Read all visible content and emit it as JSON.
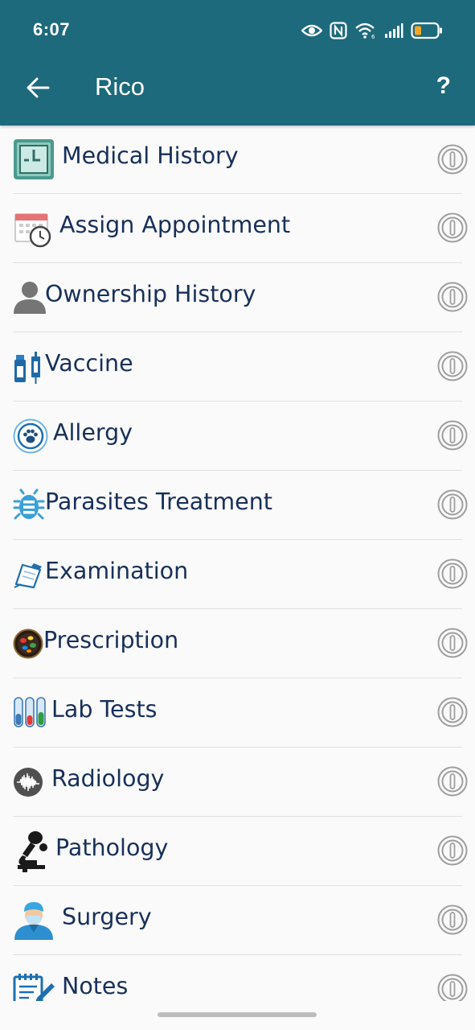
{
  "status_bar": {
    "time": "6:07",
    "icons": [
      "eye-icon",
      "nfc-icon",
      "wifi-icon",
      "signal-icon",
      "battery-icon"
    ],
    "battery_color": "#f5a623"
  },
  "app_bar": {
    "back_icon": "arrow-left-icon",
    "title": "Rico",
    "help_label": "?"
  },
  "colors": {
    "primary": "#1d6a7c",
    "label_text": "#17305a",
    "divider": "#e0e0e0",
    "background": "#fafafa"
  },
  "menu": {
    "items": [
      {
        "label": "Medical History",
        "icon": "medical-history-icon"
      },
      {
        "label": "Assign Appointment",
        "icon": "appointment-calendar-clock-icon"
      },
      {
        "label": "Ownership History",
        "icon": "person-icon"
      },
      {
        "label": "Vaccine",
        "icon": "vaccine-syringe-icon"
      },
      {
        "label": "Allergy",
        "icon": "paw-icon"
      },
      {
        "label": "Parasites Treatment",
        "icon": "bug-icon"
      },
      {
        "label": "Examination",
        "icon": "clipboard-pencil-icon"
      },
      {
        "label": "Prescription",
        "icon": "pills-icon"
      },
      {
        "label": "Lab Tests",
        "icon": "test-tubes-icon"
      },
      {
        "label": "Radiology",
        "icon": "waveform-icon"
      },
      {
        "label": "Pathology",
        "icon": "microscope-icon"
      },
      {
        "label": "Surgery",
        "icon": "surgeon-icon"
      },
      {
        "label": "Notes",
        "icon": "notes-pencil-icon"
      }
    ],
    "info_icon": "info-circle-icon"
  }
}
